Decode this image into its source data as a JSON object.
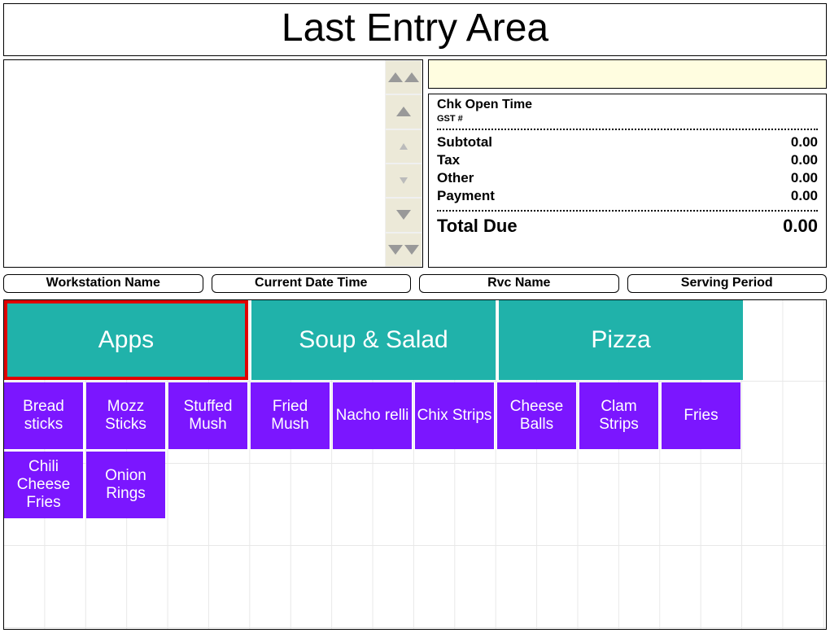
{
  "title": "Last Entry Area",
  "check": {
    "header": "Chk Open Time",
    "gst": "GST #",
    "lines": [
      {
        "label": "Subtotal",
        "value": "0.00"
      },
      {
        "label": "Tax",
        "value": "0.00"
      },
      {
        "label": "Other",
        "value": "0.00"
      },
      {
        "label": "Payment",
        "value": "0.00"
      }
    ],
    "total_label": "Total Due",
    "total_value": "0.00"
  },
  "info": {
    "workstation": "Workstation Name",
    "datetime": "Current Date Time",
    "rvc": "Rvc Name",
    "serving": "Serving Period"
  },
  "categories": [
    {
      "label": "Apps",
      "selected": true
    },
    {
      "label": "Soup & Salad",
      "selected": false
    },
    {
      "label": "Pizza",
      "selected": false
    }
  ],
  "items_row1": [
    "Bread sticks",
    "Mozz Sticks",
    "Stuffed Mush",
    "Fried Mush",
    "Nacho relli",
    "Chix Strips",
    "Cheese Balls",
    "Clam Strips",
    "Fries"
  ],
  "items_row2": [
    "Chili Cheese Fries",
    "Onion Rings"
  ]
}
